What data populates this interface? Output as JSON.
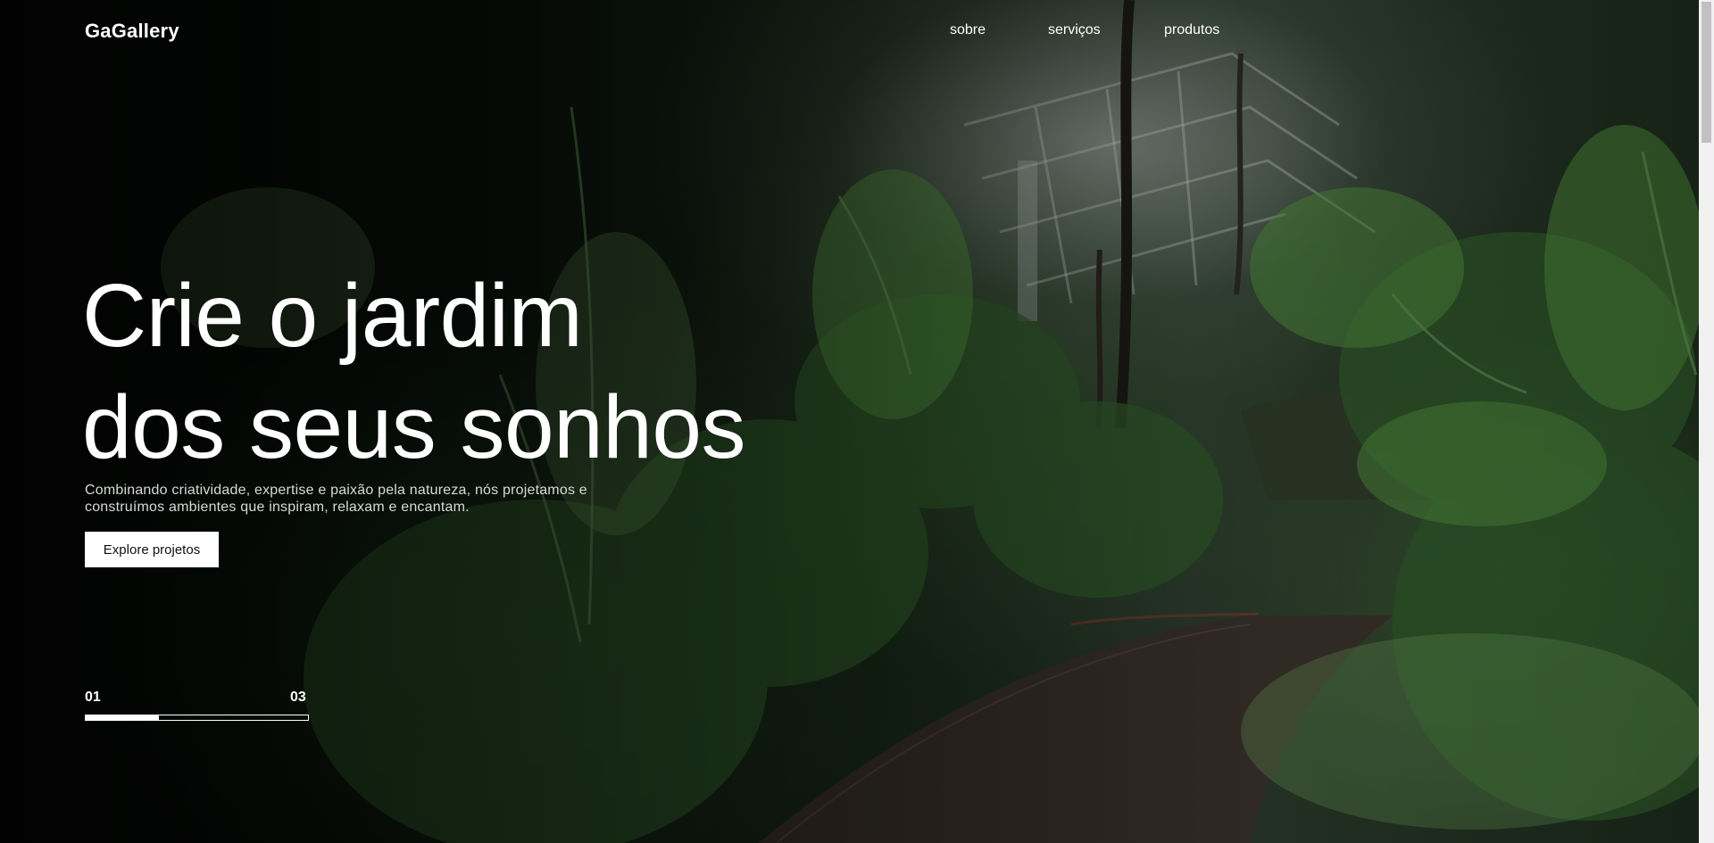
{
  "header": {
    "logo": "GaGallery",
    "nav": [
      {
        "label": "sobre"
      },
      {
        "label": "serviços"
      },
      {
        "label": "produtos"
      }
    ]
  },
  "hero": {
    "headline_line1": "Crie o jardim",
    "headline_line2": "dos seus sonhos",
    "subtext": "Combinando criatividade, expertise e paixão pela natureza, nós projetamos e construímos ambientes que inspiram, relaxam e encantam.",
    "cta_label": "Explore projetos",
    "background": "greenhouse-garden-photo"
  },
  "slider": {
    "current": "01",
    "total": "03",
    "progress_fraction": 0.33
  },
  "colors": {
    "text": "#ffffff",
    "button_bg": "#ffffff",
    "button_text": "#111111",
    "subtext": "#d6dbd6"
  }
}
